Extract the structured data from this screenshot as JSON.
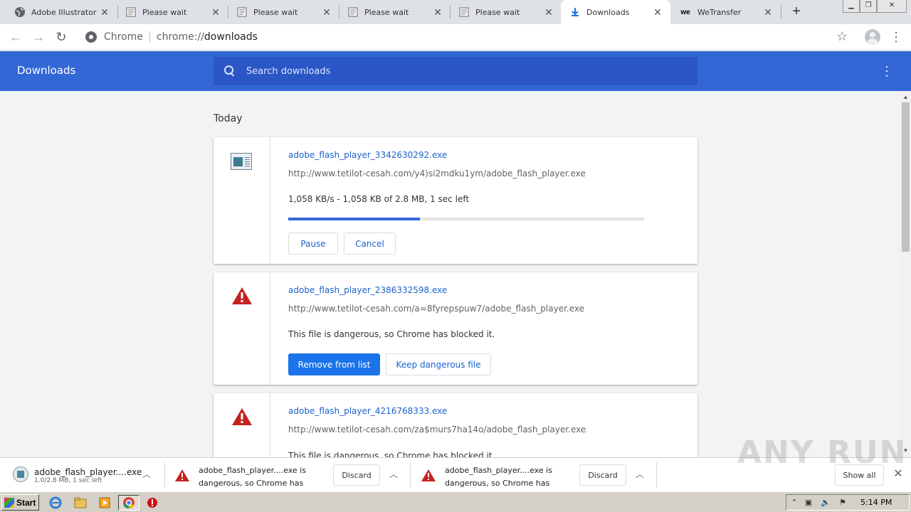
{
  "tabs": [
    {
      "title": "Adobe Illustrator C",
      "icon": "globe-icon",
      "active": false
    },
    {
      "title": "Please wait",
      "icon": "page-icon",
      "active": false
    },
    {
      "title": "Please wait",
      "icon": "page-icon",
      "active": false
    },
    {
      "title": "Please wait",
      "icon": "page-icon",
      "active": false
    },
    {
      "title": "Please wait",
      "icon": "page-icon",
      "active": false
    },
    {
      "title": "Downloads",
      "icon": "download-icon",
      "active": true
    },
    {
      "title": "WeTransfer",
      "icon": "wetransfer-icon",
      "active": false
    }
  ],
  "omnibox": {
    "site_label": "Chrome",
    "url_scheme": "chrome://",
    "url_path": "downloads"
  },
  "header": {
    "title": "Downloads",
    "search_placeholder": "Search downloads"
  },
  "section_date": "Today",
  "downloads": [
    {
      "file_name": "adobe_flash_player_3342630292.exe",
      "url": "http://www.tetilot-cesah.com/y4)si2mdku1ym/adobe_flash_player.exe",
      "status": "1,058 KB/s - 1,058 KB of 2.8 MB, 1 sec left",
      "progress": 0.37,
      "buttons": [
        "Pause",
        "Cancel"
      ]
    },
    {
      "file_name": "adobe_flash_player_2386332598.exe",
      "url": "http://www.tetilot-cesah.com/a=8fyrepspuw7/adobe_flash_player.exe",
      "status": "This file is dangerous, so Chrome has blocked it.",
      "buttons": [
        "Remove from list",
        "Keep dangerous file"
      ]
    },
    {
      "file_name": "adobe_flash_player_4216768333.exe",
      "url": "http://www.tetilot-cesah.com/za$murs7ha14o/adobe_flash_player.exe",
      "status": "This file is dangerous, so Chrome has blocked it."
    }
  ],
  "shelf": {
    "item1": {
      "name": "adobe_flash_player....exe",
      "sub": "1.0/2.8 MB, 1 sec left"
    },
    "item2": {
      "msg1": "adobe_flash_player....exe is",
      "msg2": "dangerous, so Chrome has blocked it.",
      "discard": "Discard"
    },
    "item3": {
      "msg1": "adobe_flash_player....exe is",
      "msg2": "dangerous, so Chrome has blocked it.",
      "discard": "Discard"
    },
    "show_all": "Show all"
  },
  "watermark": "ANY RUN",
  "taskbar": {
    "start_label": "Start",
    "clock": "5:14 PM"
  },
  "colors": {
    "header_blue": "#3367d6",
    "link_blue": "#1a62cc",
    "danger_red": "#c5221f"
  }
}
